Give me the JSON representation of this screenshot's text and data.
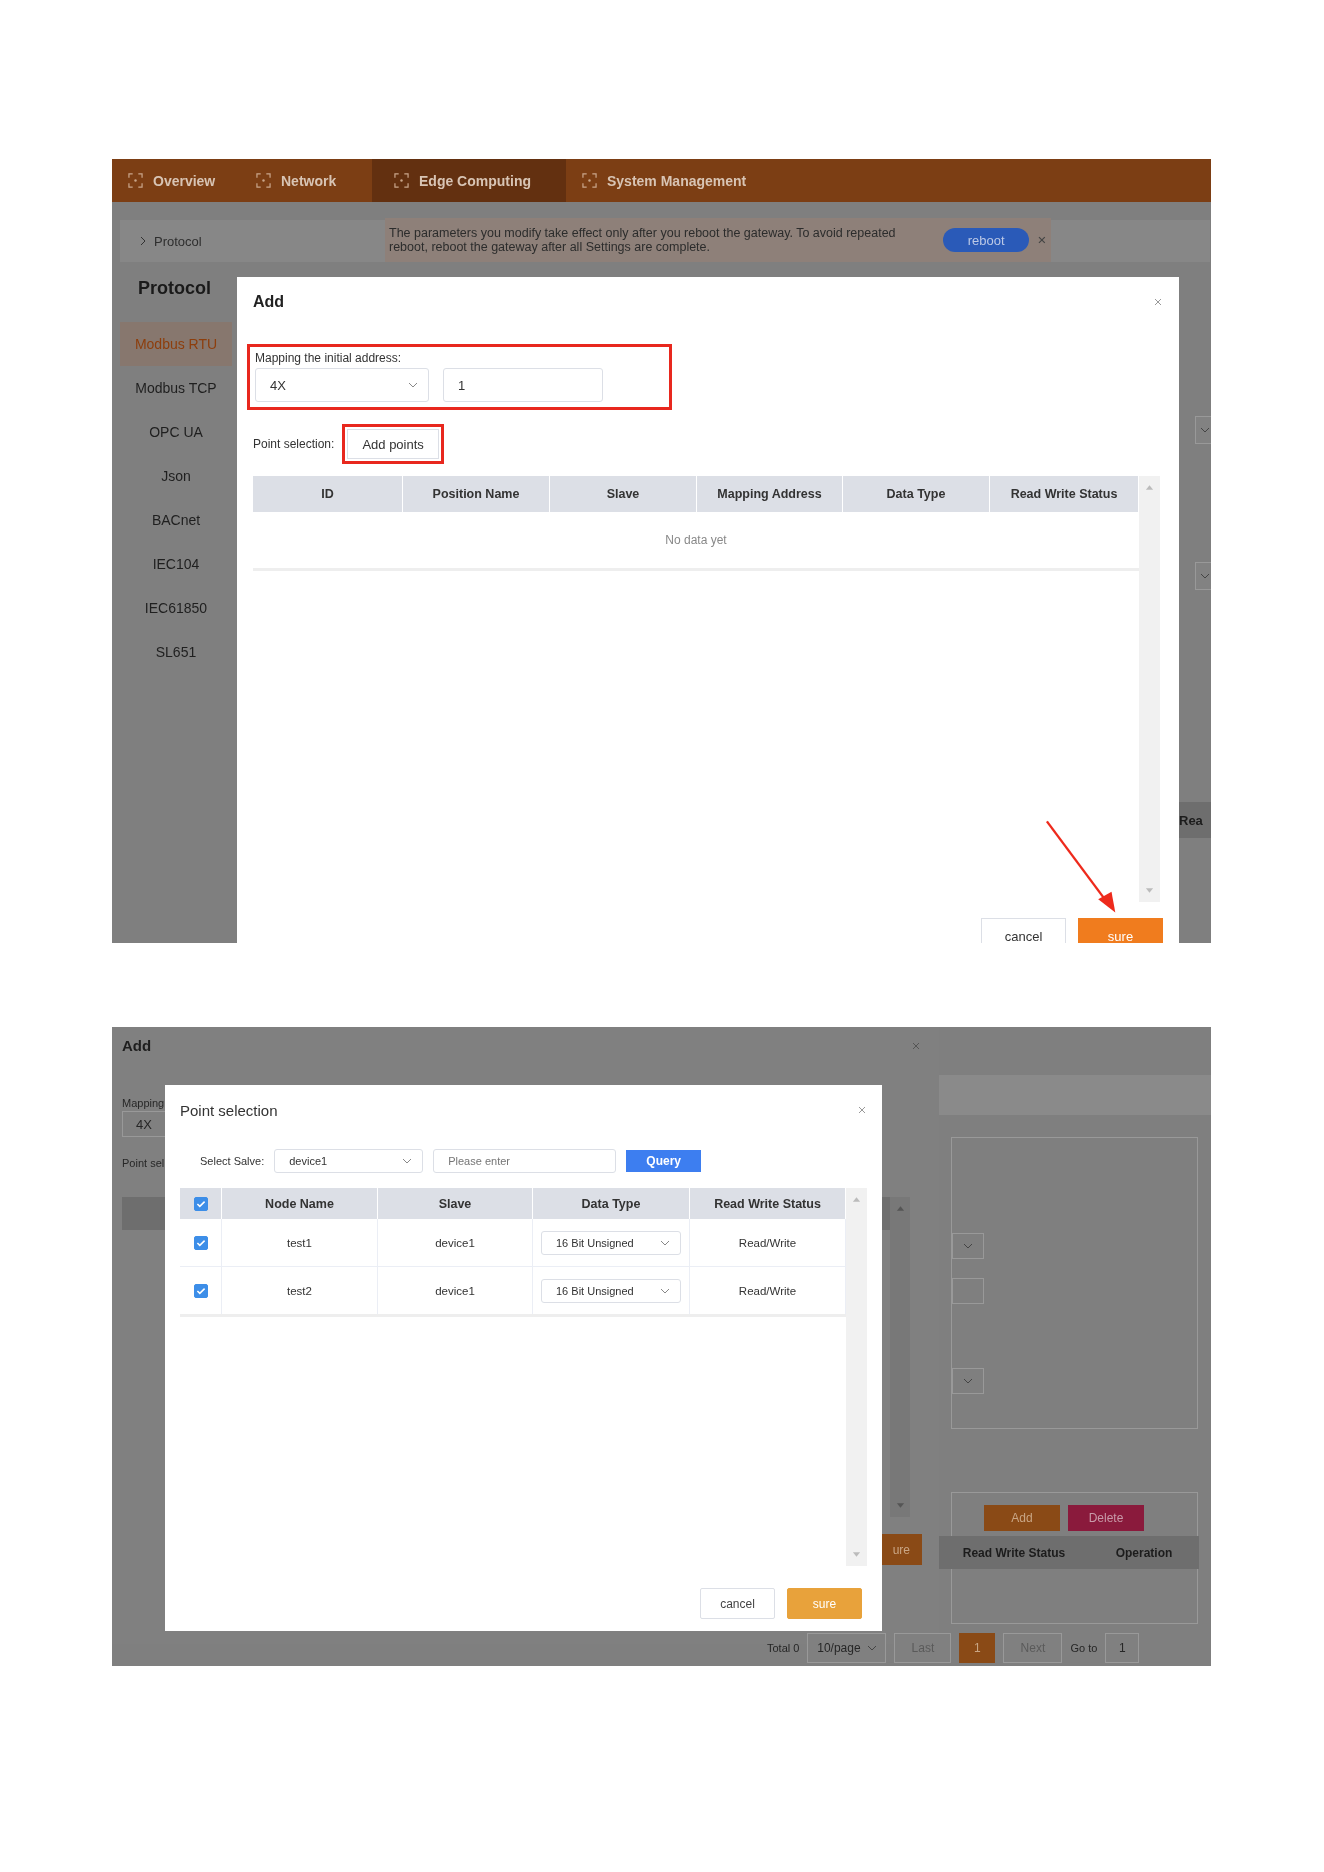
{
  "screenshot_1": {
    "nav": [
      {
        "label": "Overview",
        "selected": false
      },
      {
        "label": "Network",
        "selected": false
      },
      {
        "label": "Edge Computing",
        "selected": true
      },
      {
        "label": "System Management",
        "selected": false
      }
    ],
    "breadcrumb": "Protocol",
    "notice": {
      "text": "The parameters you modify take effect only after you reboot the gateway. To avoid repeated reboot, reboot the gateway after all Settings are complete.",
      "button": "reboot"
    },
    "page_title": "Protocol",
    "sidebar": [
      {
        "label": "Modbus RTU",
        "selected": true
      },
      {
        "label": "Modbus TCP",
        "selected": false
      },
      {
        "label": "OPC UA",
        "selected": false
      },
      {
        "label": "Json",
        "selected": false
      },
      {
        "label": "BACnet",
        "selected": false
      },
      {
        "label": "IEC104",
        "selected": false
      },
      {
        "label": "IEC61850",
        "selected": false
      },
      {
        "label": "SL651",
        "selected": false
      }
    ],
    "background_column_header": "Rea",
    "dialog": {
      "title": "Add",
      "mapping_label": "Mapping the initial address:",
      "register_select": "4X",
      "address_value": "1",
      "point_selection_label": "Point selection:",
      "add_points_button": "Add points",
      "columns": [
        "ID",
        "Position Name",
        "Slave",
        "Mapping Address",
        "Data Type",
        "Read Write Status"
      ],
      "empty_text": "No data yet",
      "buttons": [
        "cancel",
        "sure"
      ]
    }
  },
  "screenshot_2": {
    "background_dialog": {
      "title": "Add",
      "mapping_label": "Mapping",
      "register_select": "4X",
      "point_selection_label": "Point sel"
    },
    "background_page": {
      "add_button": "Add",
      "delete_button": "Delete",
      "columns": [
        "Read Write Status",
        "Operation"
      ],
      "sure_fragment": "ure",
      "pagination": {
        "total": "Total 0",
        "page_size": "10/page",
        "prev": "Last",
        "pages": [
          {
            "label": "1",
            "selected": true
          }
        ],
        "next": "Next",
        "goto_label": "Go to",
        "goto_value": "1"
      }
    },
    "dialog": {
      "title": "Point selection",
      "slave_label": "Select Salve:",
      "slave_select": "device1",
      "search_placeholder": "Please enter",
      "query_button": "Query",
      "all_checked": true,
      "columns": [
        "Node Name",
        "Slave",
        "Data Type",
        "Read Write Status"
      ],
      "rows": [
        {
          "checked": true,
          "node_name": "test1",
          "slave": "device1",
          "data_type": "16 Bit Unsigned",
          "status": "Read/Write"
        },
        {
          "checked": true,
          "node_name": "test2",
          "slave": "device1",
          "data_type": "16 Bit Unsigned",
          "status": "Read/Write"
        }
      ],
      "buttons": [
        "cancel",
        "sure"
      ]
    }
  }
}
